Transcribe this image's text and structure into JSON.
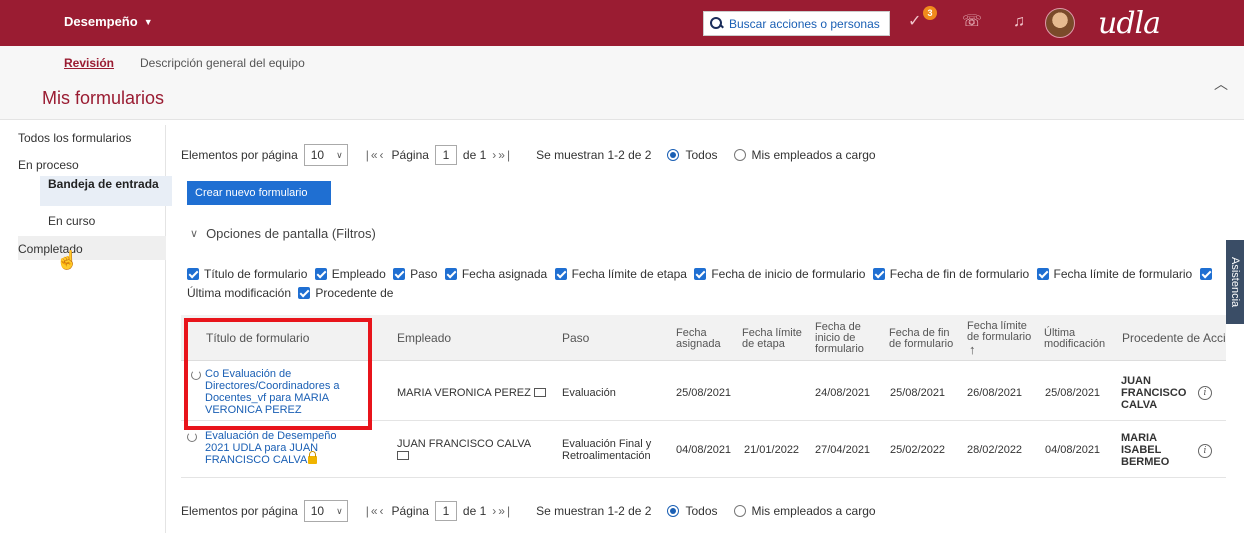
{
  "header": {
    "module": "Desempeño",
    "search_placeholder": "Buscar acciones o personas",
    "todo_badge": "3",
    "logo_text": "udla"
  },
  "subnav": {
    "revision": "Revisión",
    "team_overview": "Descripción general del equipo",
    "page_title": "Mis formularios"
  },
  "sidebar": {
    "all_forms": "Todos los formularios",
    "in_process": "En proceso",
    "inbox": "Bandeja de entrada",
    "in_progress": "En curso",
    "completed": "Completado"
  },
  "assist_tab": "Asistencia",
  "pager": {
    "items_per_page": "Elementos por página",
    "per_page_value": "10",
    "page_label": "Página",
    "page_value": "1",
    "of_label": "de 1",
    "showing": "Se muestran 1-2 de 2",
    "all_label": "Todos",
    "reports_label": "Mis empleados a cargo"
  },
  "create_button": "Crear nuevo formulario",
  "display_options": "Opciones de pantalla (Filtros)",
  "filters": [
    "Título de formulario",
    "Empleado",
    "Paso",
    "Fecha asignada",
    "Fecha límite de etapa",
    "Fecha de inicio de formulario",
    "Fecha de fin de formulario",
    "Fecha límite de formulario",
    "Última modificación",
    "Procedente de"
  ],
  "table": {
    "columns": {
      "title": "Título de formulario",
      "employee": "Empleado",
      "step": "Paso",
      "assigned": "Fecha asignada",
      "stage_due": "Fecha límite de etapa",
      "start": "Fecha de inicio de formulario",
      "end": "Fecha de fin de formulario",
      "due": "Fecha límite de formulario",
      "modified": "Última modificación",
      "from": "Procedente de",
      "action": "Acción"
    },
    "rows": [
      {
        "title": "Co Evaluación de Directores/Coordinadores a Docentes_vf para MARIA VERONICA PEREZ",
        "employee": "MARIA VERONICA PEREZ",
        "step": "Evaluación",
        "assigned": "25/08/2021",
        "stage_due": "",
        "start": "24/08/2021",
        "end": "25/08/2021",
        "due": "26/08/2021",
        "modified": "25/08/2021",
        "from": "JUAN FRANCISCO CALVA"
      },
      {
        "title": "Evaluación de Desempeño 2021 UDLA para JUAN FRANCISCO CALVA",
        "employee": "JUAN FRANCISCO CALVA",
        "step": "Evaluación Final y Retroalimentación",
        "assigned": "04/08/2021",
        "stage_due": "21/01/2022",
        "start": "27/04/2021",
        "end": "25/02/2022",
        "due": "28/02/2022",
        "modified": "04/08/2021",
        "from": "MARIA ISABEL BERMEO"
      }
    ]
  },
  "colors": {
    "brand": "#9a1c32",
    "accent": "#1f6fd2",
    "highlight": "#e8141b"
  }
}
